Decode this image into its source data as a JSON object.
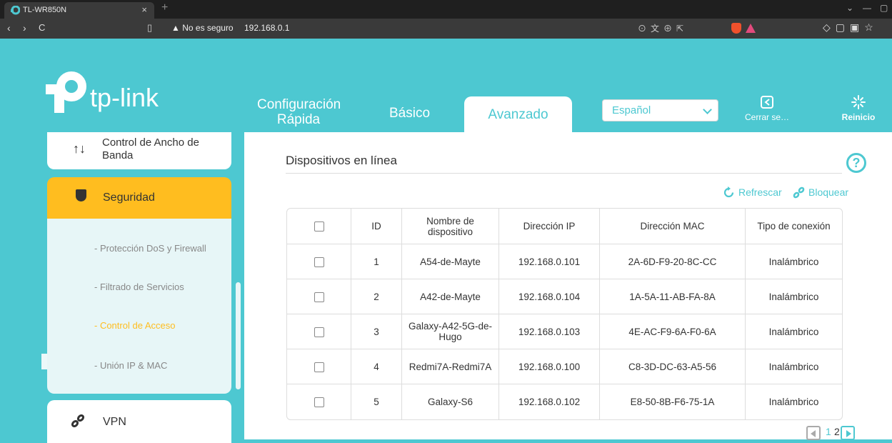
{
  "browser": {
    "tab_title": "TL-WR850N",
    "tab_close": "×",
    "new_tab": "+",
    "security_label": "No es seguro",
    "url": "192.168.0.1",
    "nav": {
      "back": "‹",
      "forward": "›",
      "reload": "C"
    },
    "window": {
      "menu": "⌄",
      "minimize": "—",
      "restore": "▢"
    }
  },
  "header": {
    "logo_text": "tp-link",
    "tabs": {
      "quick_line1": "Configuración",
      "quick_line2": "Rápida",
      "basic": "Básico",
      "advanced": "Avanzado"
    },
    "language": "Español",
    "logout": "Cerrar se…",
    "reboot": "Reinicio"
  },
  "sidebar": {
    "bandwidth": {
      "line1": "Control de Ancho de",
      "line2": "Banda"
    },
    "security": "Seguridad",
    "sub_items": [
      "- Protección DoS y Firewall",
      "- Filtrado de Servicios",
      "- Control de Acceso",
      "- Unión IP & MAC"
    ],
    "vpn": "VPN"
  },
  "main": {
    "section_title": "Dispositivos en línea",
    "help": "?",
    "refresh": "Refrescar",
    "block": "Bloquear",
    "table": {
      "headers": {
        "id": "ID",
        "name_line1": "Nombre de",
        "name_line2": "dispositivo",
        "ip": "Dirección IP",
        "mac": "Dirección MAC",
        "type": "Tipo de conexión"
      },
      "rows": [
        {
          "id": "1",
          "name": "A54-de-Mayte",
          "ip": "192.168.0.101",
          "mac": "2A-6D-F9-20-8C-CC",
          "type": "Inalámbrico"
        },
        {
          "id": "2",
          "name": "A42-de-Mayte",
          "ip": "192.168.0.104",
          "mac": "1A-5A-11-AB-FA-8A",
          "type": "Inalámbrico"
        },
        {
          "id": "3",
          "name_line1": "Galaxy-A42-5G-de-",
          "name_line2": "Hugo",
          "ip": "192.168.0.103",
          "mac": "4E-AC-F9-6A-F0-6A",
          "type": "Inalámbrico"
        },
        {
          "id": "4",
          "name": "Redmi7A-Redmi7A",
          "ip": "192.168.0.100",
          "mac": "C8-3D-DC-63-A5-56",
          "type": "Inalámbrico"
        },
        {
          "id": "5",
          "name": "Galaxy-S6",
          "ip": "192.168.0.102",
          "mac": "E8-50-8B-F6-75-1A",
          "type": "Inalámbrico"
        }
      ]
    },
    "pagination": {
      "page1": "1",
      "page2": "2"
    }
  },
  "colors": {
    "accent": "#4dc8d1",
    "highlight": "#ffbd1f",
    "text": "#333333"
  }
}
